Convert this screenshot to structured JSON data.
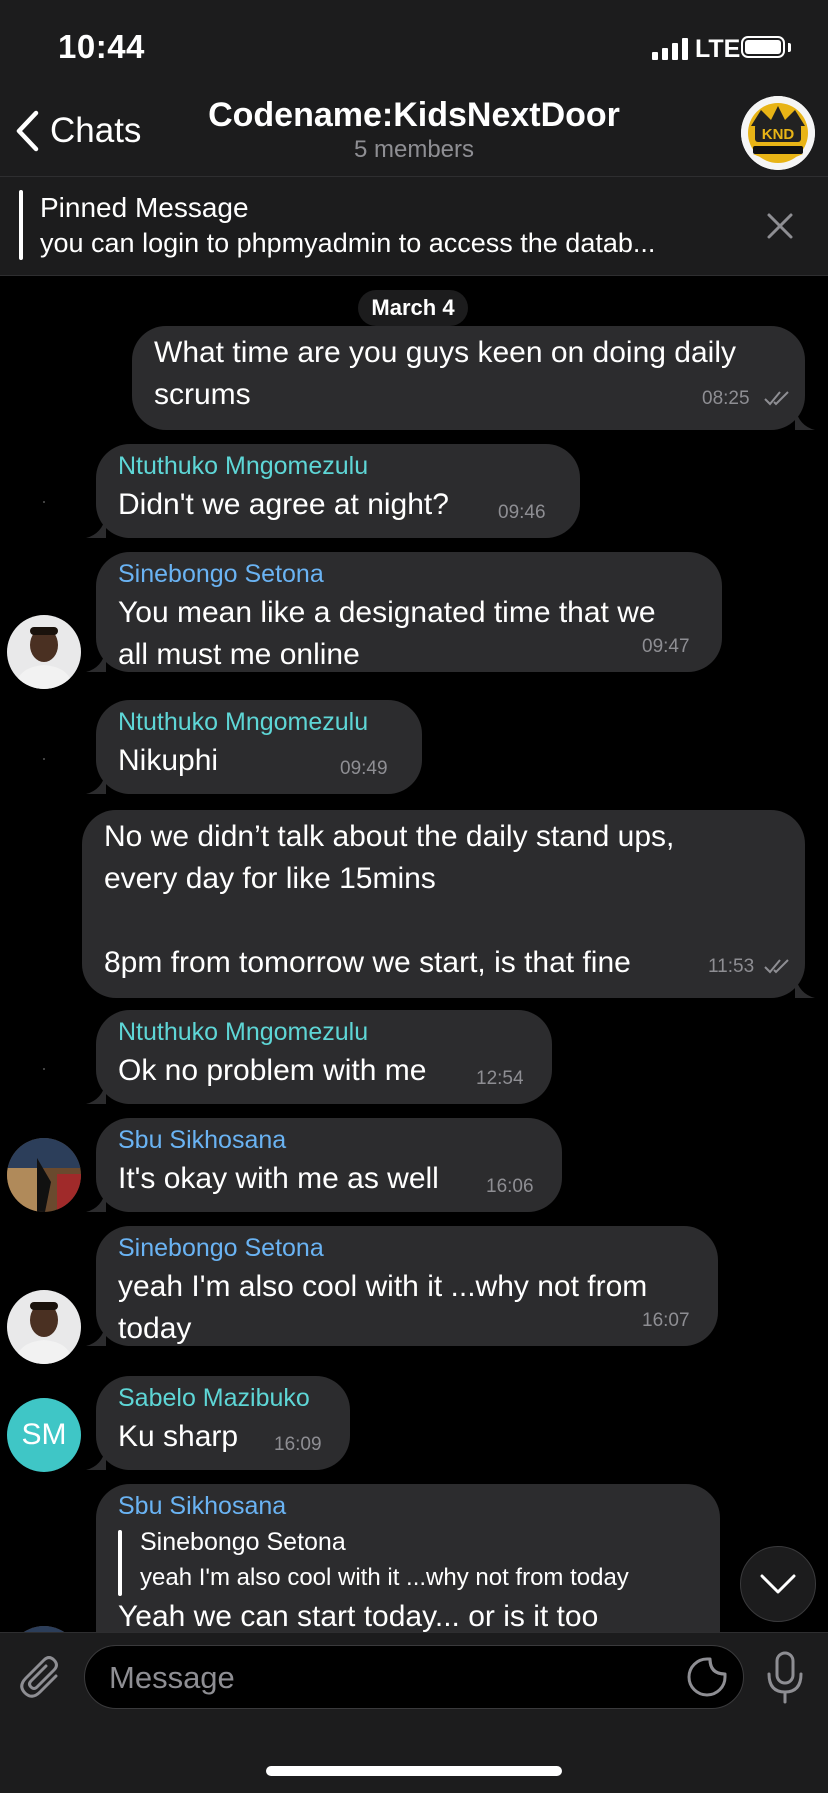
{
  "status_bar": {
    "time": "10:44",
    "network": "LTE"
  },
  "header": {
    "back_label": "Chats",
    "title": "Codename:KidsNextDoor",
    "subtitle": "5 members"
  },
  "pinned": {
    "title": "Pinned Message",
    "text": "you can login to phpmyadmin to access the datab..."
  },
  "chat": {
    "date": "March 4",
    "messages": [
      {
        "type": "out",
        "text": "What time are you guys keen on doing daily\nscrums",
        "time": "08:25"
      },
      {
        "type": "in",
        "sender": "Ntuthuko Mngomezulu",
        "sender_color": "#5ed6d6",
        "text": "Didn't we agree at night?",
        "time": "09:46"
      },
      {
        "type": "in",
        "sender": "Sinebongo Setona",
        "sender_color": "#6ab3f3",
        "text": "You mean like a designated time that we\nall must me online",
        "time": "09:47"
      },
      {
        "type": "in",
        "sender": "Ntuthuko Mngomezulu",
        "sender_color": "#5ed6d6",
        "text": "Nikuphi",
        "time": "09:49"
      },
      {
        "type": "out",
        "text": "No we didn’t talk about the daily stand ups,\nevery day for like 15mins\n\n8pm from tomorrow we start, is that fine",
        "time": "11:53"
      },
      {
        "type": "in",
        "sender": "Ntuthuko Mngomezulu",
        "sender_color": "#5ed6d6",
        "text": "Ok no problem with me",
        "time": "12:54"
      },
      {
        "type": "in",
        "sender": "Sbu Sikhosana",
        "sender_color": "#6ab3f3",
        "text": "It's okay with me as well",
        "time": "16:06"
      },
      {
        "type": "in",
        "sender": "Sinebongo Setona",
        "sender_color": "#6ab3f3",
        "text": "yeah I'm also cool with it ...why not from\ntoday",
        "time": "16:07"
      },
      {
        "type": "in",
        "sender": "Sabelo Mazibuko",
        "sender_color": "#5ed6d6",
        "avatar_initials": "SM",
        "avatar_color": "#3fc6c6",
        "text": "Ku sharp",
        "time": "16:09"
      },
      {
        "type": "in",
        "sender": "Sbu Sikhosana",
        "sender_color": "#6ab3f3",
        "reply_to": "Sinebongo Setona",
        "reply_text": "yeah I'm also cool with it ...why not from today",
        "text": "Yeah we can start today... or is it too"
      }
    ]
  },
  "input": {
    "placeholder": "Message"
  },
  "colors": {
    "background": "#000000",
    "bar": "#1c1c1d",
    "bubble": "#2c2c2e",
    "accent_teal": "#5ed6d6",
    "accent_blue": "#6ab3f3"
  }
}
